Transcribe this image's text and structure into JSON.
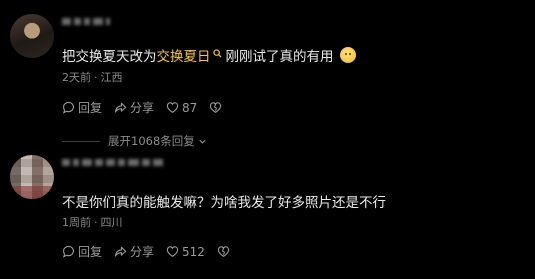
{
  "comments": [
    {
      "text_before": "把交换夏天改为",
      "highlight_link": "交换夏日",
      "text_after": "刚刚试了真的有用",
      "time": "2天前",
      "location": "江西",
      "reply_label": "回复",
      "share_label": "分享",
      "likes": "87"
    },
    {
      "text": "不是你们真的能触发嘛？为啥我发了好多照片还是不行",
      "time": "1周前",
      "location": "四川",
      "reply_label": "回复",
      "share_label": "分享",
      "likes": "512"
    }
  ],
  "expand_replies": "展开1068条回复",
  "colors": {
    "background": "#000000",
    "highlight": "#f5c542",
    "meta_text": "#8a8a8a"
  },
  "icons": {
    "reply": "comment-bubble-icon",
    "share": "share-arrow-icon",
    "like": "heart-icon",
    "dislike": "broken-heart-icon",
    "expand": "chevron-down-icon",
    "inline_search": "search-icon",
    "emoji": "emoji-icon"
  }
}
